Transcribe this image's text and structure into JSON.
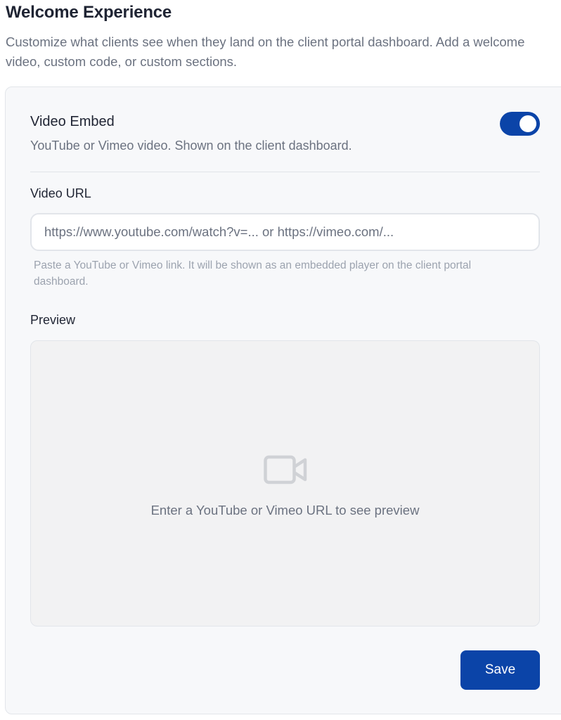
{
  "header": {
    "title": "Welcome Experience",
    "description": "Customize what clients see when they land on the client portal dashboard. Add a welcome video, custom code, or custom sections."
  },
  "video_embed": {
    "title": "Video Embed",
    "subtitle": "YouTube or Vimeo video. Shown on the client dashboard.",
    "enabled": true,
    "toggle_color": "#0b44a8"
  },
  "video_url": {
    "label": "Video URL",
    "value": "",
    "placeholder": "https://www.youtube.com/watch?v=... or https://vimeo.com/...",
    "help": "Paste a YouTube or Vimeo link. It will be shown as an embedded player on the client portal dashboard."
  },
  "preview": {
    "label": "Preview",
    "icon": "video-camera-icon",
    "empty_text": "Enter a YouTube or Vimeo URL to see preview"
  },
  "actions": {
    "save_label": "Save",
    "accent_color": "#0b44a8"
  }
}
